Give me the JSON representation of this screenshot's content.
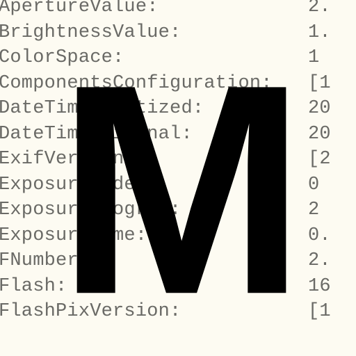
{
  "overlay": {
    "letter": "M"
  },
  "rows": [
    {
      "key": "ApertureValue:",
      "val": "2."
    },
    {
      "key": "BrightnessValue:",
      "val": "1."
    },
    {
      "key": "ColorSpace:",
      "val": "1"
    },
    {
      "key": "ComponentsConfiguration:",
      "val": "[1"
    },
    {
      "key": "DateTimeDigitized:",
      "val": "20"
    },
    {
      "key": "DateTimeOriginal:",
      "val": "20"
    },
    {
      "key": "ExifVersion:",
      "val": "[2"
    },
    {
      "key": "ExposureMode:",
      "val": "0"
    },
    {
      "key": "ExposureProgram:",
      "val": "2"
    },
    {
      "key": "ExposureTime:",
      "val": "0."
    },
    {
      "key": "FNumber:",
      "val": "2."
    },
    {
      "key": "Flash:",
      "val": "16"
    },
    {
      "key": "FlashPixVersion:",
      "val": "[1"
    }
  ]
}
